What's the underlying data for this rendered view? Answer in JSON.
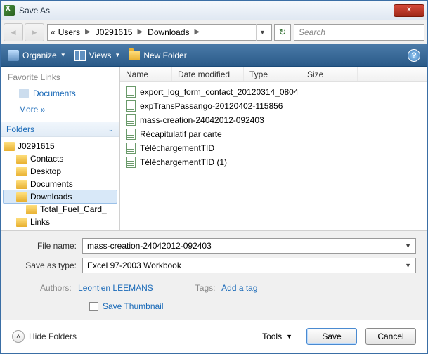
{
  "window_title": "Save As",
  "path": {
    "segments": [
      "Users",
      "J0291615",
      "Downloads"
    ]
  },
  "search": {
    "placeholder": "Search"
  },
  "toolbar": {
    "organize": "Organize",
    "views": "Views",
    "new_folder": "New Folder"
  },
  "sidebar": {
    "heading": "Favorite Links",
    "documents": "Documents",
    "more": "More",
    "folders_heading": "Folders",
    "tree": {
      "root": "J0291615",
      "items": [
        "Contacts",
        "Desktop",
        "Documents",
        "Downloads",
        "Total_Fuel_Card_",
        "Links"
      ]
    },
    "selected": "Downloads"
  },
  "columns": {
    "name": "Name",
    "date": "Date modified",
    "type": "Type",
    "size": "Size"
  },
  "files": [
    "export_log_form_contact_20120314_0804",
    "expTransPassango-20120402-115856",
    "mass-creation-24042012-092403",
    "Récapitulatif par carte",
    "TéléchargementTID",
    "TéléchargementTID (1)"
  ],
  "form": {
    "file_name_label": "File name:",
    "file_name_value": "mass-creation-24042012-092403",
    "save_type_label": "Save as type:",
    "save_type_value": "Excel 97-2003 Workbook",
    "authors_label": "Authors:",
    "authors_value": "Leontien LEEMANS",
    "tags_label": "Tags:",
    "tags_value": "Add a tag",
    "save_thumbnail": "Save Thumbnail"
  },
  "footer": {
    "hide_folders": "Hide Folders",
    "tools": "Tools",
    "save": "Save",
    "cancel": "Cancel"
  }
}
